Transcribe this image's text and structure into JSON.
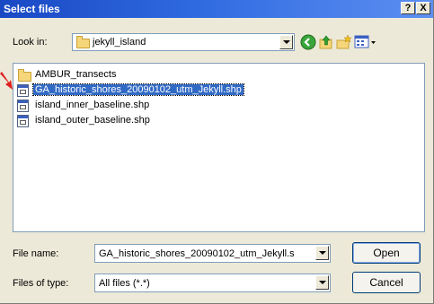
{
  "dialog": {
    "title": "Select files",
    "help_label": "?",
    "close_label": "X"
  },
  "lookin": {
    "label": "Look in:",
    "value": "jekyll_island"
  },
  "files": [
    {
      "name": "AMBUR_transects",
      "icon": "folder-icon",
      "selected": false
    },
    {
      "name": "GA_historic_shores_20090102_utm_Jekyll.shp",
      "icon": "shapefile-icon",
      "selected": true
    },
    {
      "name": "island_inner_baseline.shp",
      "icon": "shapefile-icon",
      "selected": false
    },
    {
      "name": "island_outer_baseline.shp",
      "icon": "shapefile-icon",
      "selected": false
    }
  ],
  "filename": {
    "label": "File name:",
    "value": "GA_historic_shores_20090102_utm_Jekyll.s"
  },
  "filetype": {
    "label": "Files of type:",
    "value": "All files (*.*)"
  },
  "buttons": {
    "open": "Open",
    "cancel": "Cancel"
  },
  "colors": {
    "titlebar": "#2f6ae0",
    "selection": "#316ac5",
    "dialog_bg": "#ece9d8"
  }
}
